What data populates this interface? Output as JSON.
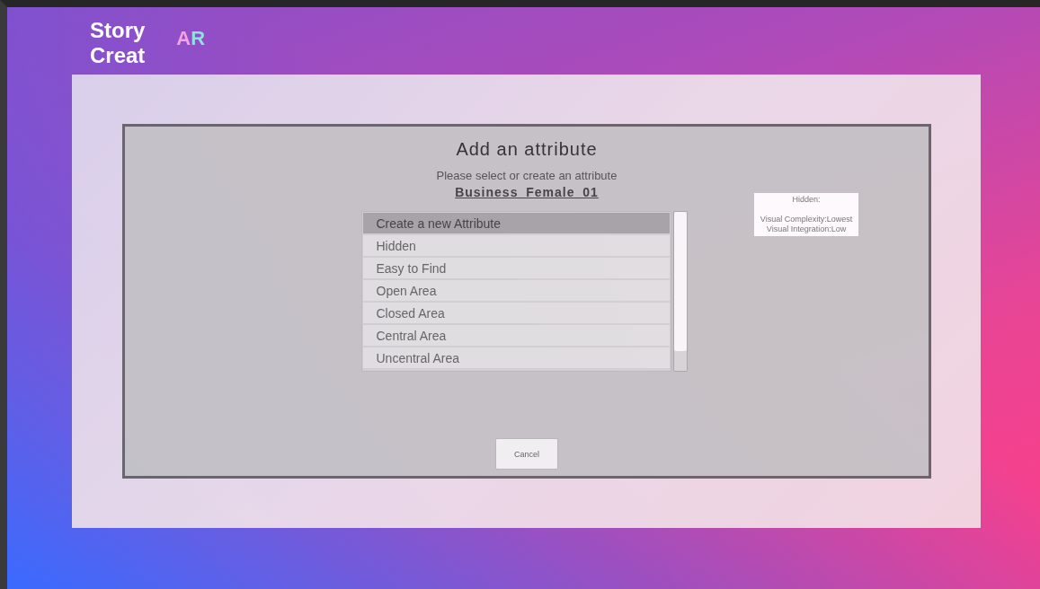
{
  "logo": {
    "lines": [
      "Story",
      "Creat"
    ],
    "badge": "AR"
  },
  "dialog": {
    "title": "Add an attribute",
    "subtitle": "Please select or create an attribute",
    "object_name": "Business_Female_01",
    "items": [
      {
        "label": "Create a new Attribute",
        "selected": true
      },
      {
        "label": "Hidden",
        "selected": false
      },
      {
        "label": "Easy to Find",
        "selected": false
      },
      {
        "label": "Open Area",
        "selected": false
      },
      {
        "label": "Closed Area",
        "selected": false
      },
      {
        "label": "Central Area",
        "selected": false
      },
      {
        "label": "Uncentral Area",
        "selected": false
      }
    ],
    "tooltip": {
      "title": "Hidden:",
      "lines": [
        "Visual Complexity:Lowest",
        "Visual Integration:Low"
      ]
    },
    "cancel_button": "Cancel"
  }
}
